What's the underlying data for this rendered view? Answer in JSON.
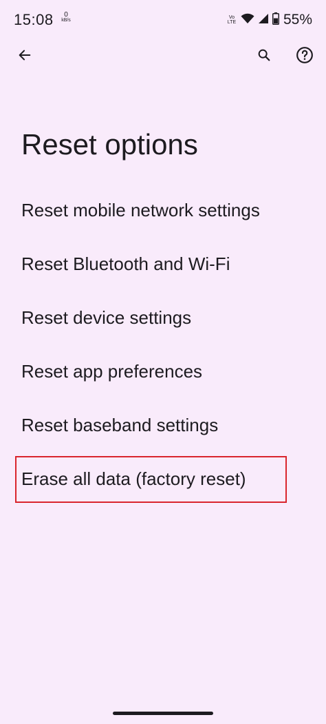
{
  "status_bar": {
    "time": "15:08",
    "net_speed_value": "0",
    "net_speed_unit": "kB/s",
    "volte_top": "Vo",
    "volte_bottom": "LTE",
    "battery_percent": "55%",
    "icons": [
      "wifi-icon",
      "signal-icon",
      "battery-icon"
    ]
  },
  "toolbar": {
    "back_icon": "arrow-left-icon",
    "search_icon": "search-icon",
    "help_icon": "help-circle-icon"
  },
  "page": {
    "title": "Reset options"
  },
  "options": [
    {
      "label": "Reset mobile network settings"
    },
    {
      "label": "Reset Bluetooth and Wi-Fi"
    },
    {
      "label": "Reset device settings"
    },
    {
      "label": "Reset app preferences"
    },
    {
      "label": "Reset baseband settings"
    },
    {
      "label": "Erase all data (factory reset)"
    }
  ],
  "colors": {
    "background": "#f9ebfb",
    "text": "#1d1b20",
    "highlight": "#d9242c"
  }
}
